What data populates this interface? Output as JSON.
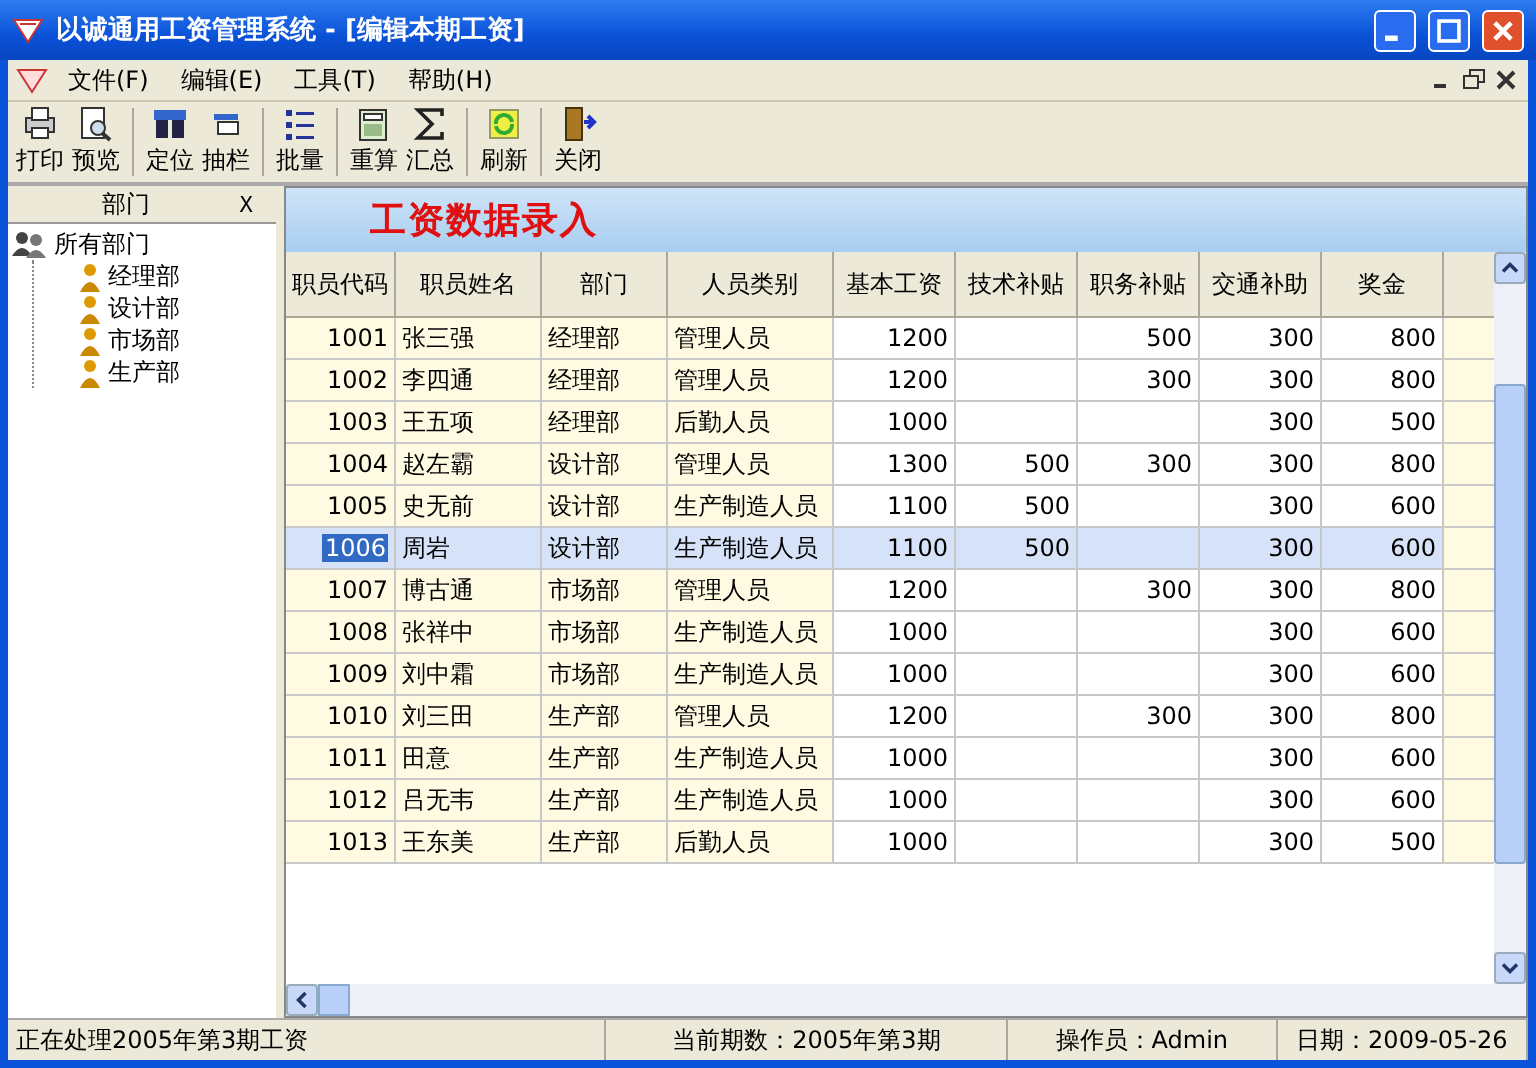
{
  "window": {
    "title": "以诚通用工资管理系统 - [编辑本期工资]"
  },
  "menu": [
    "文件(F)",
    "编辑(E)",
    "工具(T)",
    "帮助(H)"
  ],
  "toolbar": [
    {
      "label": "打印"
    },
    {
      "label": "预览"
    },
    {
      "label": "定位"
    },
    {
      "label": "抽栏"
    },
    {
      "label": "批量"
    },
    {
      "label": "重算"
    },
    {
      "label": "汇总"
    },
    {
      "label": "刷新"
    },
    {
      "label": "关闭"
    }
  ],
  "sidebar": {
    "title": "部门",
    "close": "X",
    "tree": [
      {
        "label": "所有部门",
        "children": [
          {
            "label": "经理部"
          },
          {
            "label": "设计部"
          },
          {
            "label": "市场部"
          },
          {
            "label": "生产部"
          }
        ]
      }
    ]
  },
  "banner": "工资数据录入",
  "table": {
    "columns": [
      "职员代码",
      "职员姓名",
      "部门",
      "人员类别",
      "基本工资",
      "技术补贴",
      "职务补贴",
      "交通补助",
      "奖金"
    ],
    "rows": [
      {
        "selected": false,
        "cells": [
          "1001",
          "张三强",
          "经理部",
          "管理人员",
          "1200",
          "",
          "500",
          "300",
          "800"
        ]
      },
      {
        "selected": false,
        "cells": [
          "1002",
          "李四通",
          "经理部",
          "管理人员",
          "1200",
          "",
          "300",
          "300",
          "800"
        ]
      },
      {
        "selected": false,
        "cells": [
          "1003",
          "王五项",
          "经理部",
          "后勤人员",
          "1000",
          "",
          "",
          "300",
          "500"
        ]
      },
      {
        "selected": false,
        "cells": [
          "1004",
          "赵左霸",
          "设计部",
          "管理人员",
          "1300",
          "500",
          "300",
          "300",
          "800"
        ]
      },
      {
        "selected": false,
        "cells": [
          "1005",
          "史无前",
          "设计部",
          "生产制造人员",
          "1100",
          "500",
          "",
          "300",
          "600"
        ]
      },
      {
        "selected": true,
        "cells": [
          "1006",
          "周岩",
          "设计部",
          "生产制造人员",
          "1100",
          "500",
          "",
          "300",
          "600"
        ]
      },
      {
        "selected": false,
        "cells": [
          "1007",
          "博古通",
          "市场部",
          "管理人员",
          "1200",
          "",
          "300",
          "300",
          "800"
        ]
      },
      {
        "selected": false,
        "cells": [
          "1008",
          "张祥中",
          "市场部",
          "生产制造人员",
          "1000",
          "",
          "",
          "300",
          "600"
        ]
      },
      {
        "selected": false,
        "cells": [
          "1009",
          "刘中霜",
          "市场部",
          "生产制造人员",
          "1000",
          "",
          "",
          "300",
          "600"
        ]
      },
      {
        "selected": false,
        "cells": [
          "1010",
          "刘三田",
          "生产部",
          "管理人员",
          "1200",
          "",
          "300",
          "300",
          "800"
        ]
      },
      {
        "selected": false,
        "cells": [
          "1011",
          "田意",
          "生产部",
          "生产制造人员",
          "1000",
          "",
          "",
          "300",
          "600"
        ]
      },
      {
        "selected": false,
        "cells": [
          "1012",
          "吕无韦",
          "生产部",
          "生产制造人员",
          "1000",
          "",
          "",
          "300",
          "600"
        ]
      },
      {
        "selected": false,
        "cells": [
          "1013",
          "王东美",
          "生产部",
          "后勤人员",
          "1000",
          "",
          "",
          "300",
          "500"
        ]
      }
    ]
  },
  "status_bar": [
    "正在处理2005年第3期工资",
    "当前期数：2005年第3期",
    "操作员：Admin",
    "日期：2009-05-26"
  ]
}
